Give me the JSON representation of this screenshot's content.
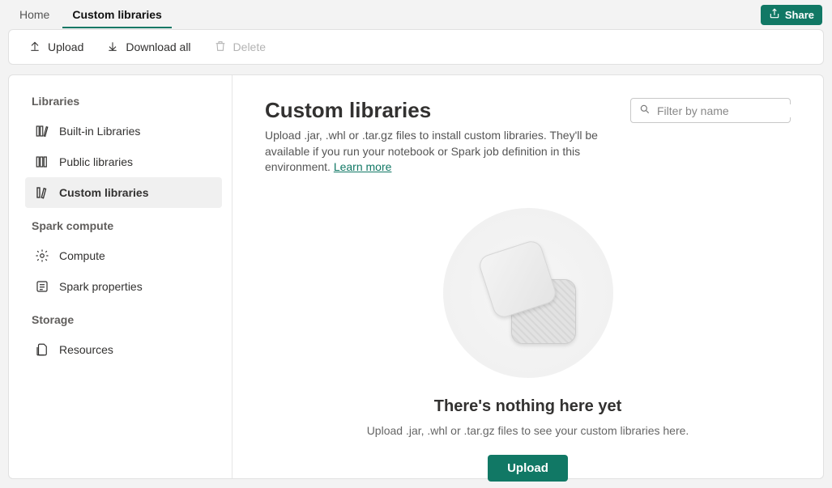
{
  "header": {
    "tabs": [
      {
        "label": "Home",
        "active": false
      },
      {
        "label": "Custom libraries",
        "active": true
      }
    ],
    "share_label": "Share"
  },
  "toolbar": {
    "upload_label": "Upload",
    "download_label": "Download all",
    "delete_label": "Delete"
  },
  "sidebar": {
    "sections": {
      "libraries": {
        "title": "Libraries",
        "items": [
          {
            "label": "Built-in Libraries"
          },
          {
            "label": "Public libraries"
          },
          {
            "label": "Custom libraries"
          }
        ]
      },
      "spark": {
        "title": "Spark compute",
        "items": [
          {
            "label": "Compute"
          },
          {
            "label": "Spark properties"
          }
        ]
      },
      "storage": {
        "title": "Storage",
        "items": [
          {
            "label": "Resources"
          }
        ]
      }
    }
  },
  "content": {
    "title": "Custom libraries",
    "description_pre": "Upload .jar, .whl or .tar.gz files to install custom libraries. They'll be available if you run your notebook or Spark job definition in this environment. ",
    "learn_more": "Learn more",
    "filter_placeholder": "Filter by name",
    "empty": {
      "title": "There's nothing here yet",
      "subtitle": "Upload .jar, .whl or .tar.gz files to see your custom libraries here.",
      "button_label": "Upload"
    }
  }
}
